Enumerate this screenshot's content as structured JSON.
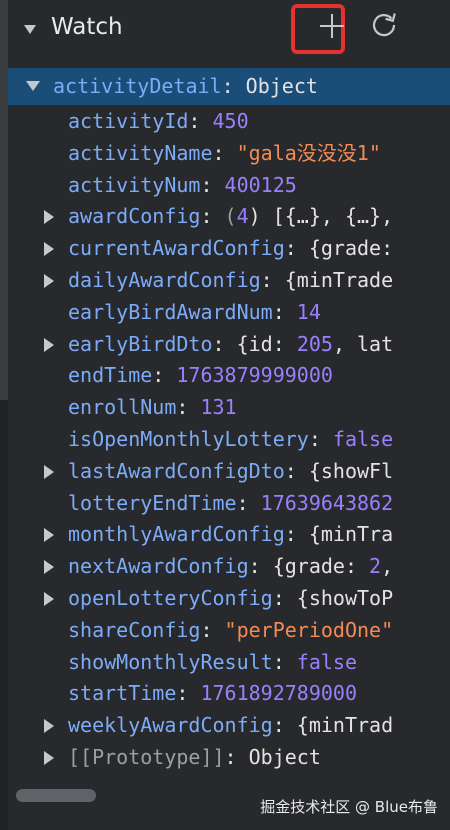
{
  "watch": {
    "title": "Watch",
    "add_icon": "plus-icon",
    "refresh_icon": "refresh-icon",
    "highlight_color": "#e5322e"
  },
  "root": {
    "key": "activityDetail",
    "value": "Object"
  },
  "rows": [
    {
      "key": "activityId",
      "type": "num",
      "value": "450",
      "expandable": false
    },
    {
      "key": "activityName",
      "type": "str",
      "value": "\"gala没没没1\"",
      "expandable": false
    },
    {
      "key": "activityNum",
      "type": "num",
      "value": "400125",
      "expandable": false
    },
    {
      "key": "awardConfig",
      "type": "obj",
      "value": "(4) [{…}, {…},",
      "expandable": true
    },
    {
      "key": "currentAwardConfig",
      "type": "obj",
      "value": "{grade:",
      "expandable": true
    },
    {
      "key": "dailyAwardConfig",
      "type": "obj",
      "value": "{minTrade",
      "expandable": true
    },
    {
      "key": "earlyBirdAwardNum",
      "type": "num",
      "value": "14",
      "expandable": false
    },
    {
      "key": "earlyBirdDto",
      "type": "obj",
      "value": "{id: 205, lat",
      "expandable": true
    },
    {
      "key": "endTime",
      "type": "num",
      "value": "1763879999000",
      "expandable": false
    },
    {
      "key": "enrollNum",
      "type": "num",
      "value": "131",
      "expandable": false
    },
    {
      "key": "isOpenMonthlyLottery",
      "type": "kw",
      "value": "false",
      "expandable": false
    },
    {
      "key": "lastAwardConfigDto",
      "type": "obj",
      "value": "{showFl",
      "expandable": true
    },
    {
      "key": "lotteryEndTime",
      "type": "num",
      "value": "17639643862",
      "expandable": false
    },
    {
      "key": "monthlyAwardConfig",
      "type": "obj",
      "value": "{minTra",
      "expandable": true
    },
    {
      "key": "nextAwardConfig",
      "type": "obj",
      "value": "{grade: 2,",
      "expandable": true
    },
    {
      "key": "openLotteryConfig",
      "type": "obj",
      "value": "{showToP",
      "expandable": true
    },
    {
      "key": "shareConfig",
      "type": "str",
      "value": "\"perPeriodOne\"",
      "expandable": false
    },
    {
      "key": "showMonthlyResult",
      "type": "kw",
      "value": "false",
      "expandable": false
    },
    {
      "key": "startTime",
      "type": "num",
      "value": "1761892789000",
      "expandable": false
    },
    {
      "key": "weeklyAwardConfig",
      "type": "obj",
      "value": "{minTrad",
      "expandable": true
    },
    {
      "key": "[[Prototype]]",
      "type": "proto",
      "value": "Object",
      "expandable": true
    }
  ],
  "watermark": "掘金技术社区 @ Blue布鲁"
}
